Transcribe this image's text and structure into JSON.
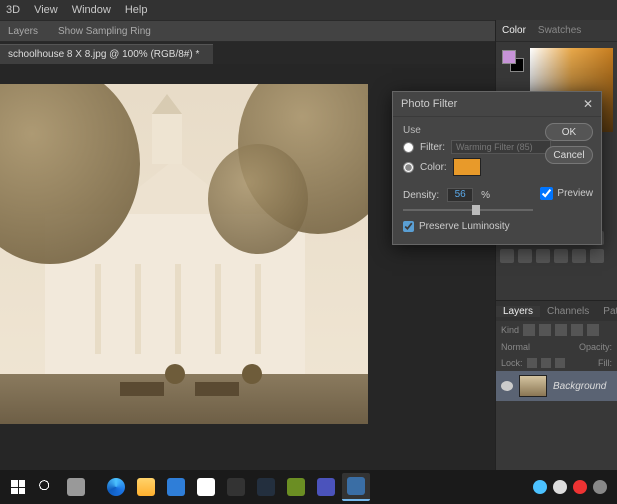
{
  "menu": {
    "d3": "3D",
    "view": "View",
    "window": "Window",
    "help": "Help"
  },
  "optbar": {
    "layers": "Layers",
    "sampling": "Show Sampling Ring"
  },
  "tab": {
    "title": "schoolhouse 8 X 8.jpg @ 100% (RGB/8#) *"
  },
  "colorpanel": {
    "color": "Color",
    "swatches": "Swatches"
  },
  "dialog": {
    "title": "Photo Filter",
    "use": "Use",
    "filter": "Filter:",
    "filtername": "Warming Filter (85)",
    "color": "Color:",
    "swatch": "#e89a2a",
    "ok": "OK",
    "cancel": "Cancel",
    "preview": "Preview",
    "density": "Density:",
    "density_value": "56",
    "pct": "%",
    "preserve": "Preserve Luminosity"
  },
  "layers": {
    "tab_layers": "Layers",
    "tab_channels": "Channels",
    "tab_paths": "Paths",
    "kind": "Kind",
    "blend": "Normal",
    "opacity": "Opacity:",
    "lock": "Lock:",
    "fill": "Fill:",
    "bg": "Background"
  }
}
